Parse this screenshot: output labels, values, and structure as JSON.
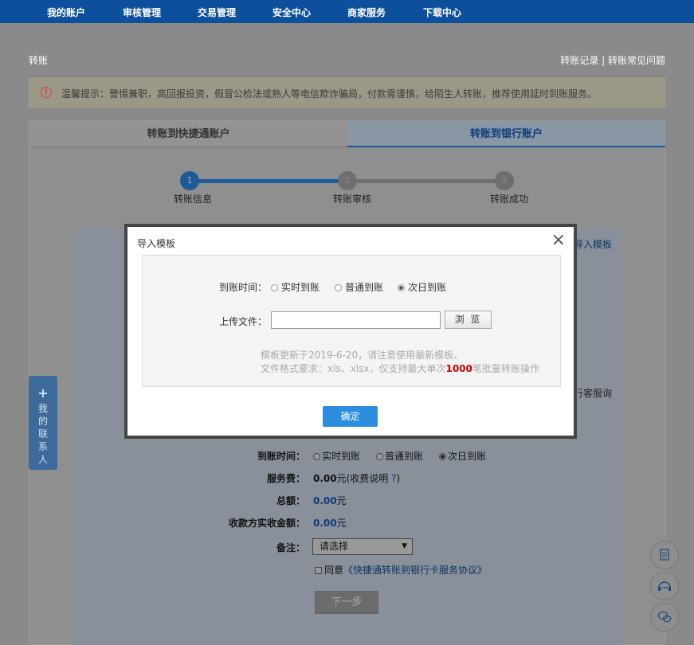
{
  "nav": {
    "items": [
      "我的账户",
      "审核管理",
      "交易管理",
      "安全中心",
      "商家服务",
      "下载中心"
    ]
  },
  "page": {
    "title": "转账",
    "link_records": "转账记录",
    "link_sep": " | ",
    "link_faq": "转账常见问题"
  },
  "warning": {
    "icon": "!",
    "text": "温馨提示：警惕兼职，高回报投资，假冒公检法或熟人等电信欺诈骗局，付款需谨慎，给陌生人转账，推荐使用延时到账服务。"
  },
  "tabs": {
    "tab1": "转账到快捷通账户",
    "tab2": "转账到银行账户"
  },
  "steps": {
    "s1_num": "1",
    "s1_label": "转账信息",
    "s2_num": "2",
    "s2_label": "转账审核",
    "s3_num": "3",
    "s3_label": "转账成功",
    "progress_fraction": 0.5
  },
  "form": {
    "import_link": "导入模板",
    "cs_text": "行客服询",
    "arrival_label": "到账时间：",
    "arrival_options": [
      "实时到账",
      "普通到账",
      "次日到账"
    ],
    "arrival_selected": 2,
    "fee_label": "服务费：",
    "fee_value": "0.00",
    "fee_suffix": "元(收费说明",
    "fee_help": "?",
    "fee_close": ")",
    "total_label": "总额：",
    "total_value": "0.00",
    "total_unit": "元",
    "receive_label": "收款方实收金额：",
    "receive_value": "0.00",
    "receive_unit": "元",
    "remark_label": "备注：",
    "remark_value": "请选择",
    "agree_text": "同意",
    "agree_link": "《快捷通转账到银行卡服务协议》",
    "next_button": "下一步"
  },
  "contact": {
    "plus": "+",
    "label": "我的联系人"
  },
  "modal": {
    "title": "导入模板",
    "close": "×",
    "arrival_label": "到账时间：",
    "arrival_options": [
      "实时到账",
      "普通到账",
      "次日到账"
    ],
    "arrival_selected": 2,
    "upload_label": "上传文件：",
    "upload_value": "",
    "browse_button": "浏 览",
    "note1": "模板更新于2019-6-20，请注意使用最新模板。",
    "note2_prefix": "文件格式要求：xls、xlsx，仅支持最大单次",
    "note2_num": "1000",
    "note2_suffix": "笔批量转账操作",
    "ok_button": "确定"
  }
}
